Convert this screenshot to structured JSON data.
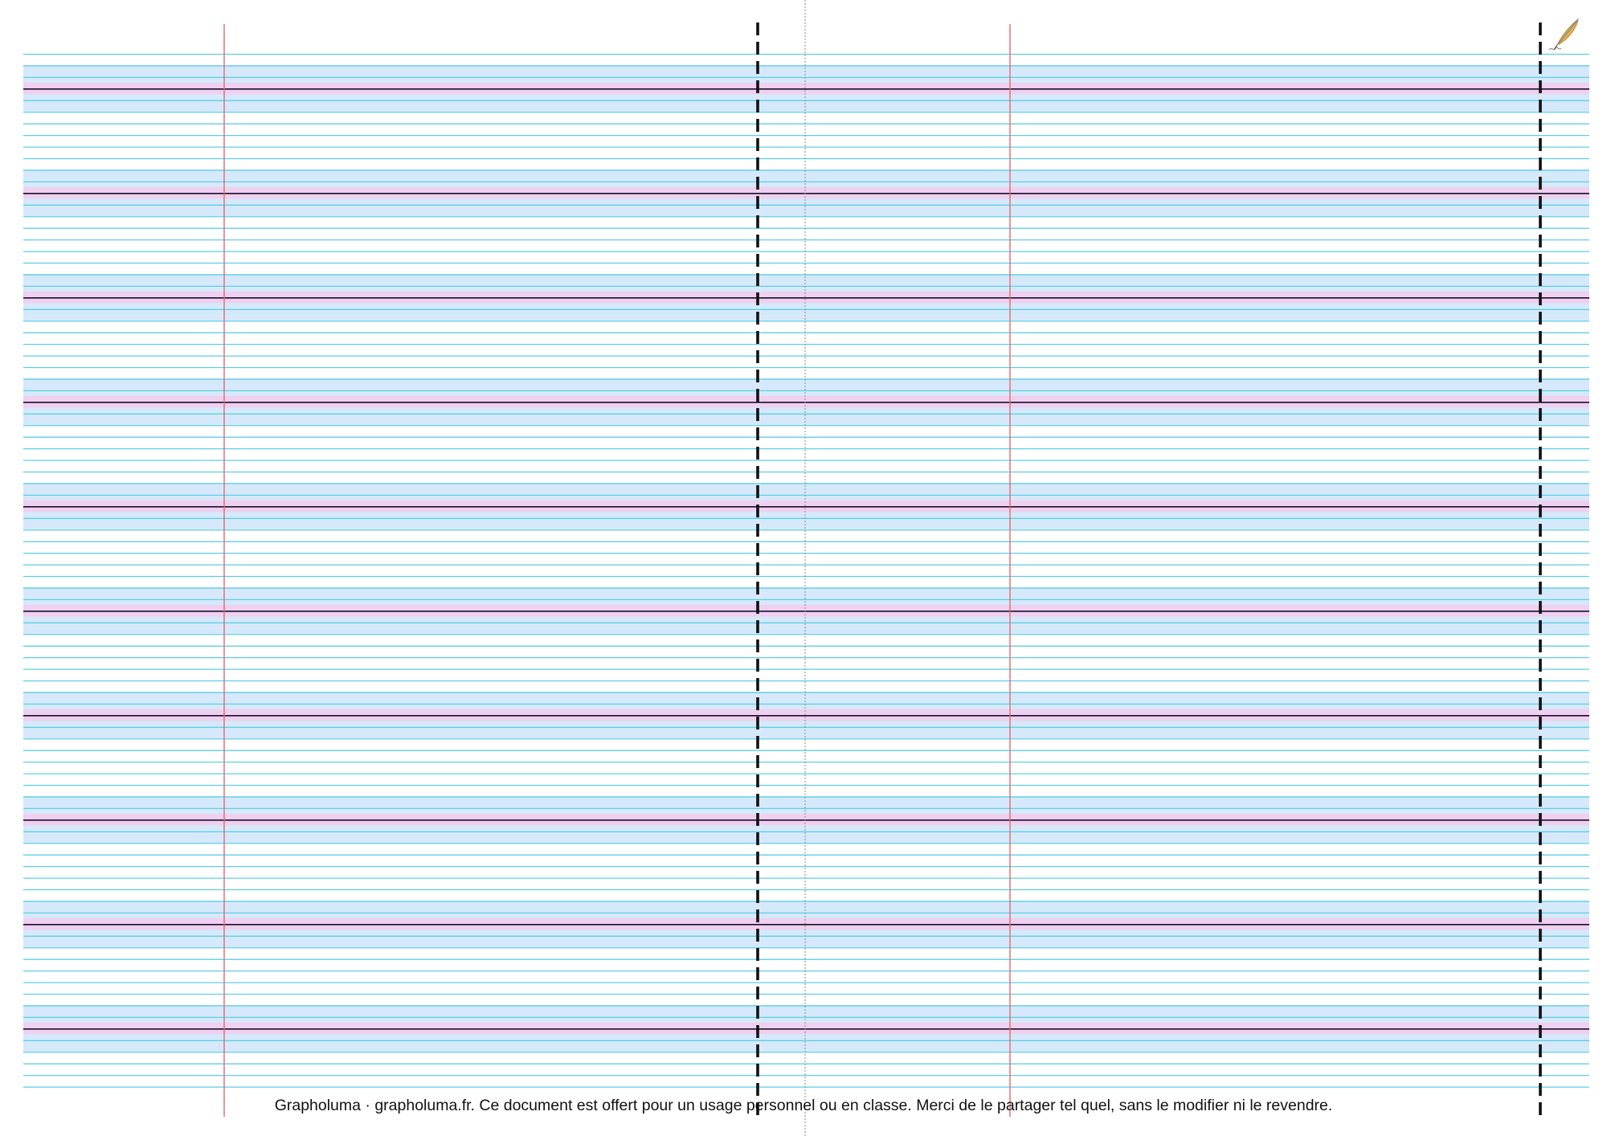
{
  "footer": {
    "text": "Grapholuma · grapholuma.fr. Ce document est offert pour un usage personnel ou en classe. Merci de le partager tel quel, sans le modifier ni le revendre."
  },
  "logo": {
    "icon": "quill-pen-icon"
  },
  "ruling": {
    "columns": 2,
    "line_groups": 10,
    "colors": {
      "guide_line": "#5ccfe6",
      "blue_band": "#d6e9fb",
      "pink_band": "#efd0ef",
      "baseline": "#1a0f2e",
      "margin_line": "#e06a6a",
      "cut_line": "#111111",
      "fold_line": "#888888"
    }
  }
}
